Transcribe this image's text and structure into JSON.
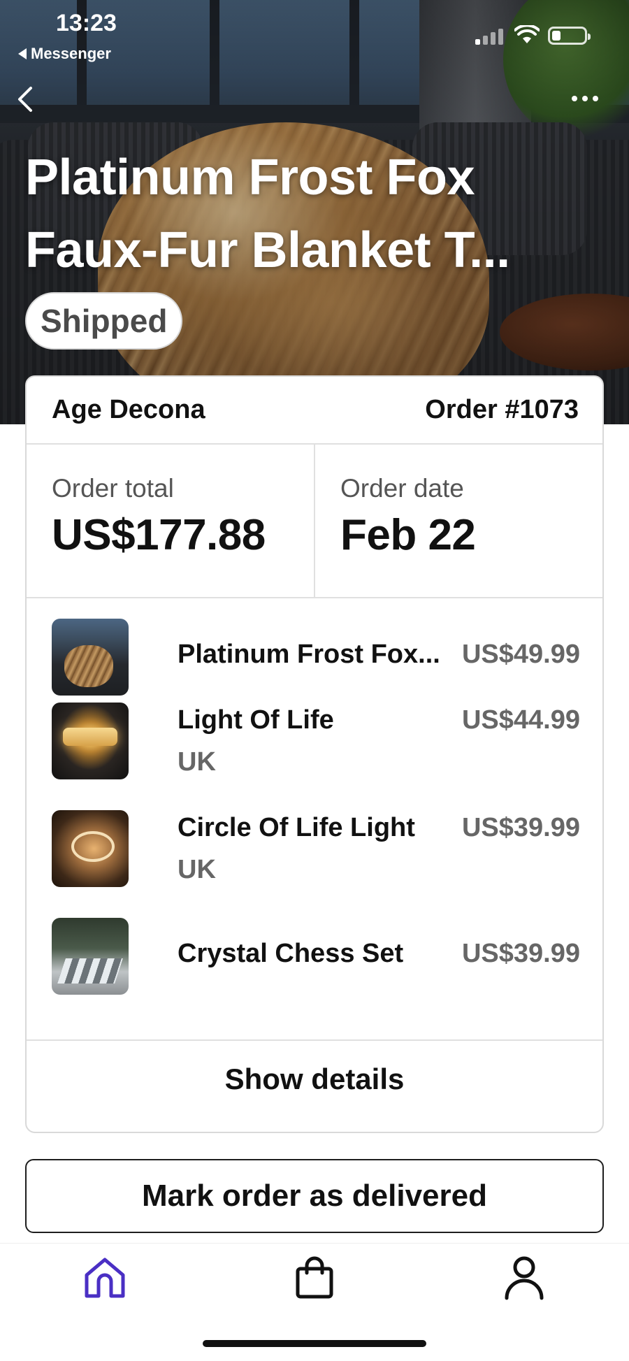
{
  "status_bar": {
    "time": "13:23",
    "back_app": "Messenger"
  },
  "header": {
    "title_line1": "Platinum Frost Fox",
    "title_line2": "Faux-Fur Blanket T...",
    "status": "Shipped",
    "back_icon": "chevron-left-icon",
    "more_icon": "more-horizontal-icon"
  },
  "order": {
    "customer": "Age Decona",
    "number": "Order #1073",
    "total_label": "Order total",
    "total_value": "US$177.88",
    "date_label": "Order date",
    "date_value": "Feb 22",
    "items": [
      {
        "name": "Platinum Frost Fox...",
        "sub": "",
        "price": "US$49.99"
      },
      {
        "name": "Light Of Life",
        "sub": "UK",
        "price": "US$44.99"
      },
      {
        "name": "Circle Of Life Light",
        "sub": "UK",
        "price": "US$39.99"
      },
      {
        "name": "Crystal Chess Set",
        "sub": "",
        "price": "US$39.99"
      }
    ],
    "show_details": "Show details"
  },
  "actions": {
    "mark_delivered": "Mark order as delivered"
  },
  "tabbar": {
    "tabs": [
      {
        "icon": "home-icon",
        "active": true
      },
      {
        "icon": "shopping-bag-icon",
        "active": false
      },
      {
        "icon": "user-icon",
        "active": false
      }
    ],
    "accent": "#4a2fc4"
  }
}
